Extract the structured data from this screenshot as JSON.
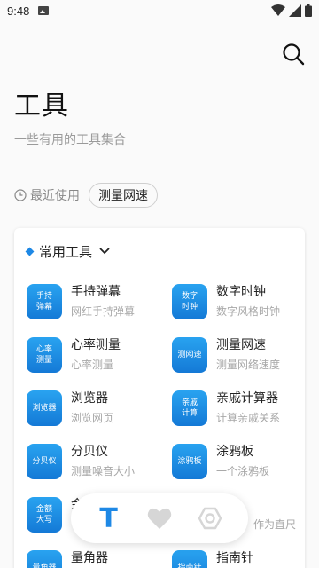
{
  "status_bar": {
    "time": "9:48"
  },
  "header": {
    "title": "工具",
    "subtitle": "一些有用的工具集合"
  },
  "recent": {
    "label": "最近使用",
    "chip": "测量网速"
  },
  "card": {
    "title": "常用工具",
    "tools": [
      {
        "icon": "手持弹幕",
        "name": "手持弹幕",
        "desc": "网红手持弹幕"
      },
      {
        "icon": "数字时钟",
        "name": "数字时钟",
        "desc": "数字风格时钟"
      },
      {
        "icon": "心率测量",
        "name": "心率测量",
        "desc": "心率测量"
      },
      {
        "icon": "测网速",
        "name": "测量网速",
        "desc": "测量网络速度"
      },
      {
        "icon": "浏览器",
        "name": "浏览器",
        "desc": "浏览网页"
      },
      {
        "icon": "亲戚计算",
        "name": "亲戚计算器",
        "desc": "计算亲戚关系"
      },
      {
        "icon": "分贝仪",
        "name": "分贝仪",
        "desc": "测量噪音大小"
      },
      {
        "icon": "涂鸦板",
        "name": "涂鸦板",
        "desc": "一个涂鸦板"
      },
      {
        "icon": "金额大写",
        "name": "金",
        "desc": ""
      },
      {
        "icon": "",
        "name": "",
        "desc": "作为直尺"
      },
      {
        "icon": "量角器",
        "name": "量角器",
        "desc": ""
      },
      {
        "icon": "指南针",
        "name": "指南针",
        "desc": ""
      }
    ]
  },
  "bottom_nav": {
    "active_glyph": "T"
  },
  "colors": {
    "accent": "#1e88e5",
    "icon_top": "#29a3f0",
    "icon_bottom": "#1479d6"
  }
}
